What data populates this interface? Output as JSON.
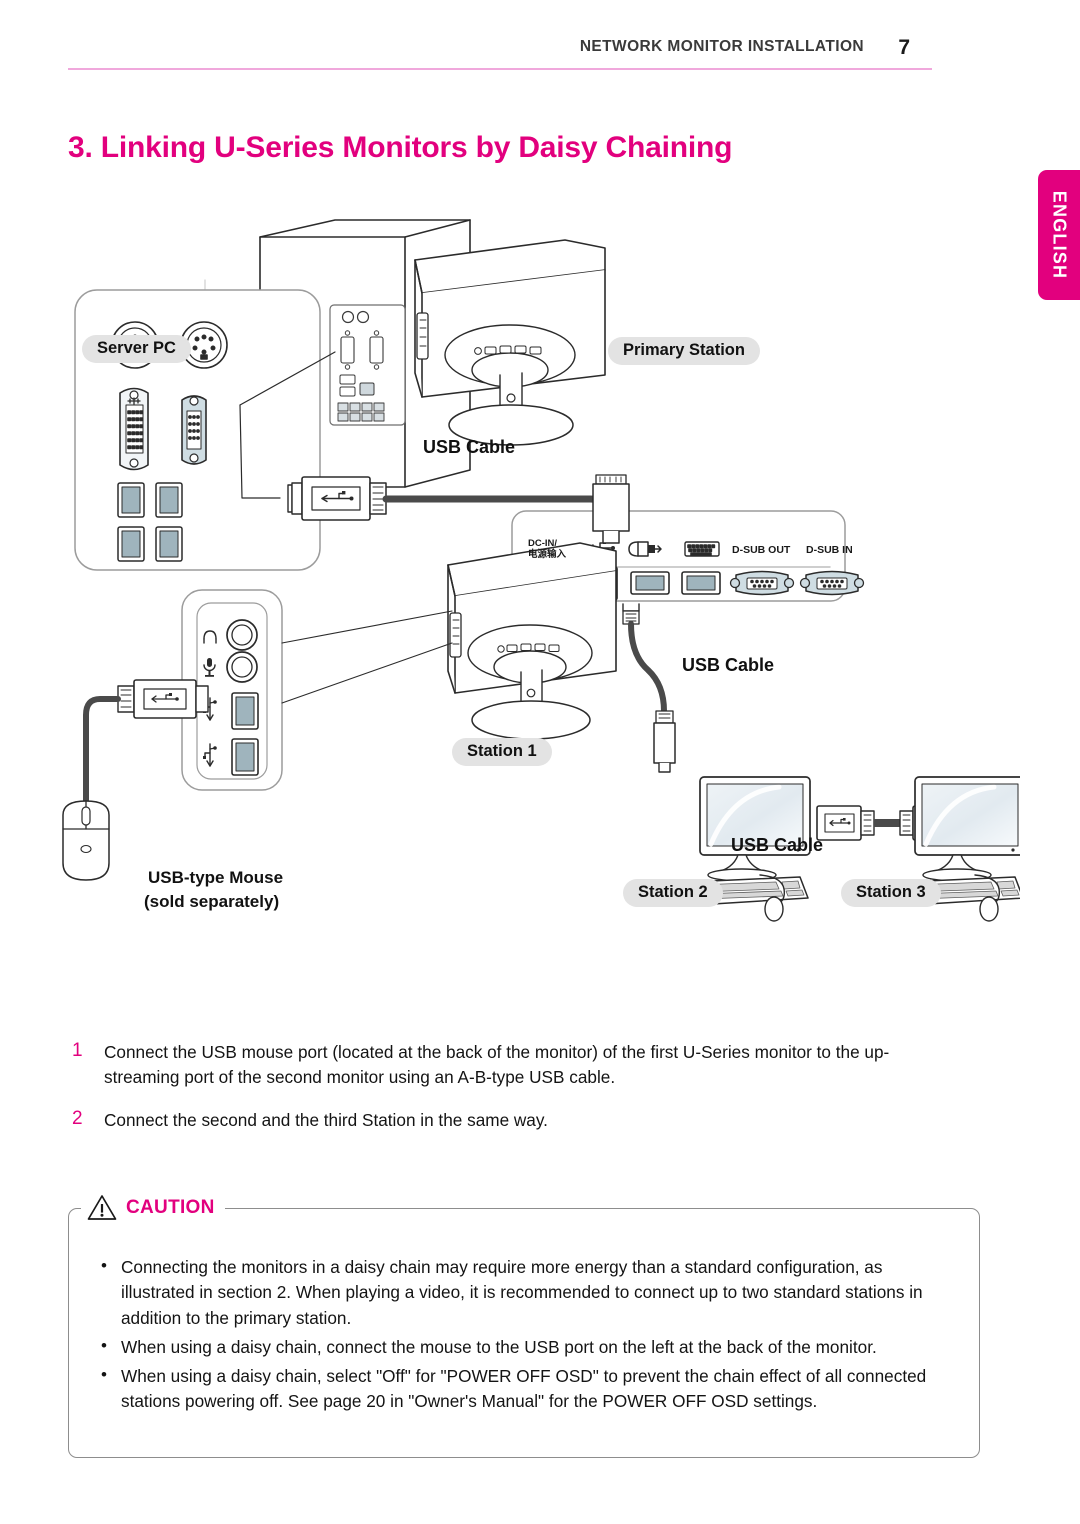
{
  "header": {
    "title": "NETWORK MONITOR INSTALLATION",
    "page_number": "7",
    "rule_color": "#f0a8dc"
  },
  "language_tab": {
    "label": "ENGLISH",
    "color": "#e2007e"
  },
  "section": {
    "title": "3. Linking U-Series Monitors by Daisy Chaining",
    "accent_color": "#e2007e"
  },
  "diagram": {
    "labels": {
      "server_pc": "Server PC",
      "primary_station": "Primary Station",
      "station_1": "Station 1",
      "station_2": "Station 2",
      "station_3": "Station 3",
      "usb_cable_top": "USB Cable",
      "usb_cable_middle": "USB Cable",
      "usb_cable_bottom": "USB Cable",
      "mouse_line1": "USB-type Mouse",
      "mouse_line2": "(sold separately)"
    },
    "port_panel": {
      "dc_in_line1": "DC-IN/",
      "dc_in_line2": "电源输入",
      "usb_icon": "usb-icon",
      "mouse_icon": "mouse-icon",
      "keyboard_icon": "keyboard-icon",
      "dsub_out": "D-SUB OUT",
      "dsub_in": "D-SUB IN"
    },
    "side_panel_icons": {
      "headphone": "headphone-icon",
      "microphone": "microphone-icon",
      "usb_down_1": "usb-downstream-icon",
      "usb_down_2": "usb-downstream-icon"
    }
  },
  "steps": [
    {
      "number": "1",
      "text": "Connect the USB mouse port (located at the back of the monitor) of the first U-Series monitor to the up-streaming port of the second monitor using an A-B-type USB cable."
    },
    {
      "number": "2",
      "text": "Connect the second and the third Station in the same way."
    }
  ],
  "caution": {
    "title": "CAUTION",
    "icon": "warning-triangle-icon",
    "items": [
      "Connecting the monitors in a daisy chain may require more energy than a standard configuration, as illustrated in section 2. When playing a video, it is recommended to connect up to two standard stations in addition to the primary station.",
      "When using a daisy chain, connect the mouse to the USB port on the left at the back of the monitor.",
      "When using a daisy chain, select \"Off\" for \"POWER OFF OSD\" to prevent the chain effect of all connected stations powering off. See page 20 in \"Owner's Manual\" for the POWER OFF OSD settings."
    ]
  }
}
